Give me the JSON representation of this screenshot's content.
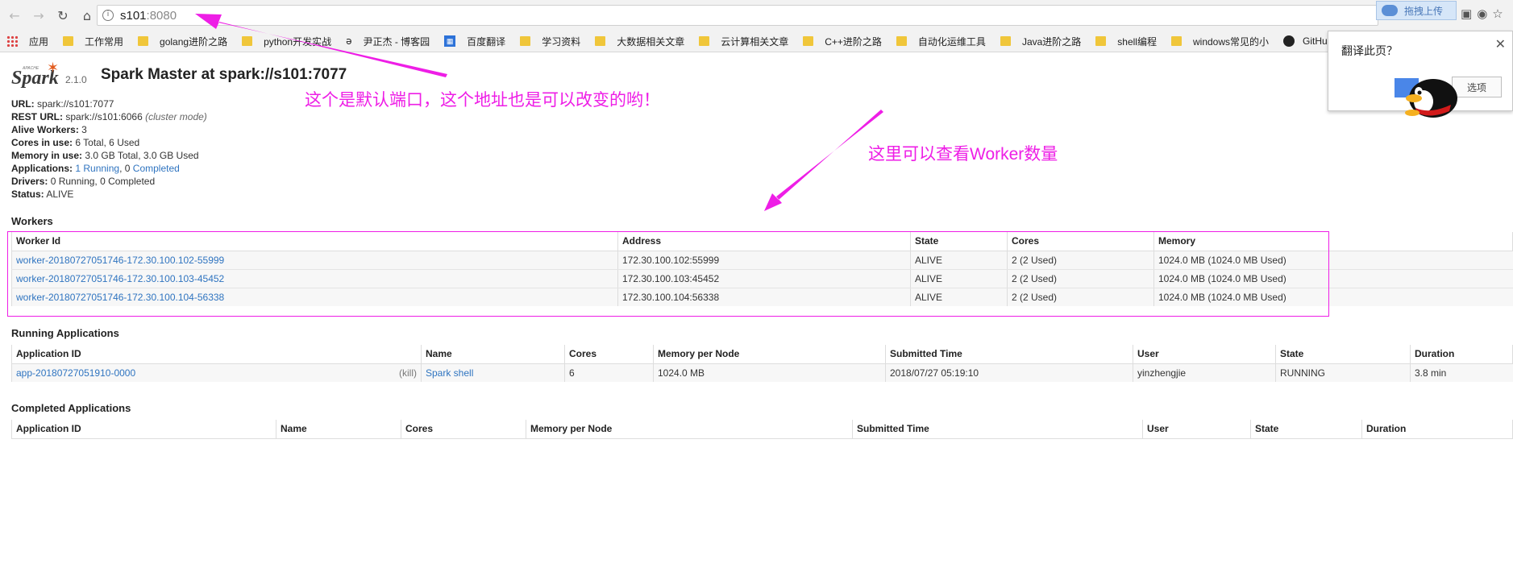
{
  "browser": {
    "url_host": "s101",
    "url_port": ":8080",
    "upload_label": "拖拽上传",
    "bookmarks": [
      "应用",
      "工作常用",
      "golang进阶之路",
      "python开发实战",
      "尹正杰 - 博客园",
      "百度翻译",
      "学习资料",
      "大数据相关文章",
      "云计算相关文章",
      "C++进阶之路",
      "自动化运维工具",
      "Java进阶之路",
      "shell编程",
      "windows常见的小",
      "GitHub"
    ],
    "translate": {
      "title": "翻译此页？",
      "options_label": "选项"
    }
  },
  "spark": {
    "logo_apache": "APACHE",
    "logo_text": "Spark",
    "version": "2.1.0",
    "title": "Spark Master at spark://s101:7077",
    "info": {
      "url_label": "URL:",
      "url_value": "spark://s101:7077",
      "rest_label": "REST URL:",
      "rest_value": "spark://s101:6066",
      "rest_mode": "(cluster mode)",
      "workers_label": "Alive Workers:",
      "workers_value": "3",
      "cores_label": "Cores in use:",
      "cores_value": "6 Total, 6 Used",
      "memory_label": "Memory in use:",
      "memory_value": "3.0 GB Total, 3.0 GB Used",
      "apps_label": "Applications:",
      "apps_running": "1 Running",
      "apps_sep": ", ",
      "apps_completed_count": "0",
      "apps_completed": "Completed",
      "drivers_label": "Drivers:",
      "drivers_value": "0 Running, 0 Completed",
      "status_label": "Status:",
      "status_value": "ALIVE"
    },
    "workers": {
      "title": "Workers",
      "headers": [
        "Worker Id",
        "Address",
        "State",
        "Cores",
        "Memory"
      ],
      "rows": [
        [
          "worker-20180727051746-172.30.100.102-55999",
          "172.30.100.102:55999",
          "ALIVE",
          "2 (2 Used)",
          "1024.0 MB (1024.0 MB Used)"
        ],
        [
          "worker-20180727051746-172.30.100.103-45452",
          "172.30.100.103:45452",
          "ALIVE",
          "2 (2 Used)",
          "1024.0 MB (1024.0 MB Used)"
        ],
        [
          "worker-20180727051746-172.30.100.104-56338",
          "172.30.100.104:56338",
          "ALIVE",
          "2 (2 Used)",
          "1024.0 MB (1024.0 MB Used)"
        ]
      ]
    },
    "running": {
      "title": "Running Applications",
      "headers": [
        "Application ID",
        "Name",
        "Cores",
        "Memory per Node",
        "Submitted Time",
        "User",
        "State",
        "Duration"
      ],
      "rows": [
        {
          "id": "app-20180727051910-0000",
          "kill": "(kill)",
          "name": "Spark shell",
          "cores": "6",
          "memory": "1024.0 MB",
          "submitted": "2018/07/27 05:19:10",
          "user": "yinzhengjie",
          "state": "RUNNING",
          "duration": "3.8 min"
        }
      ]
    },
    "completed": {
      "title": "Completed Applications",
      "headers": [
        "Application ID",
        "Name",
        "Cores",
        "Memory per Node",
        "Submitted Time",
        "User",
        "State",
        "Duration"
      ]
    }
  },
  "annotations": {
    "port_note": "这个是默认端口，这个地址也是可以改变的哟！",
    "worker_note": "这里可以查看Worker数量"
  },
  "colors": {
    "annotation": "#ee1ee6",
    "link": "#2f74c0"
  }
}
